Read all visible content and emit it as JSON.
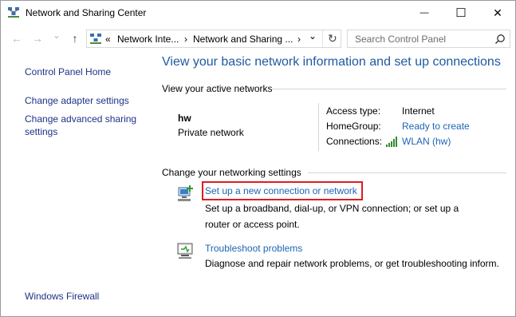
{
  "window": {
    "title": "Network and Sharing Center",
    "minimize": "—",
    "maximize": "☐",
    "close": "✕"
  },
  "nav": {
    "back": "←",
    "forward": "→",
    "recent": "⌄",
    "up": "↑",
    "address_overflow": "«",
    "address_crumb1": "Network Inte...",
    "address_crumb2": "Network and Sharing ...",
    "address_dropdown": "⌄",
    "refresh": "↻",
    "search_placeholder": "Search Control Panel"
  },
  "left_pane": {
    "home": "Control Panel Home",
    "adapter": "Change adapter settings",
    "advanced_line1": "Change advanced sharing",
    "advanced_line2": "settings",
    "firewall": "Windows Firewall"
  },
  "main": {
    "heading": "View your basic network information and set up connections",
    "active_networks_label": "View your active networks",
    "network_name": "hw",
    "network_type": "Private network",
    "access_type_label": "Access type:",
    "access_type_value": "Internet",
    "homegroup_label": "HomeGroup:",
    "homegroup_value": "Ready to create",
    "connections_label": "Connections:",
    "connections_value": "WLAN (hw)",
    "change_settings_label": "Change your networking settings",
    "setup_link": "Set up a new connection or network",
    "setup_desc_line1": "Set up a broadband, dial-up, or VPN connection; or set up a",
    "setup_desc_line2": "router or access point.",
    "troubleshoot_link": "Troubleshoot problems",
    "troubleshoot_desc": "Diagnose and repair network problems, or get troubleshooting inform."
  }
}
